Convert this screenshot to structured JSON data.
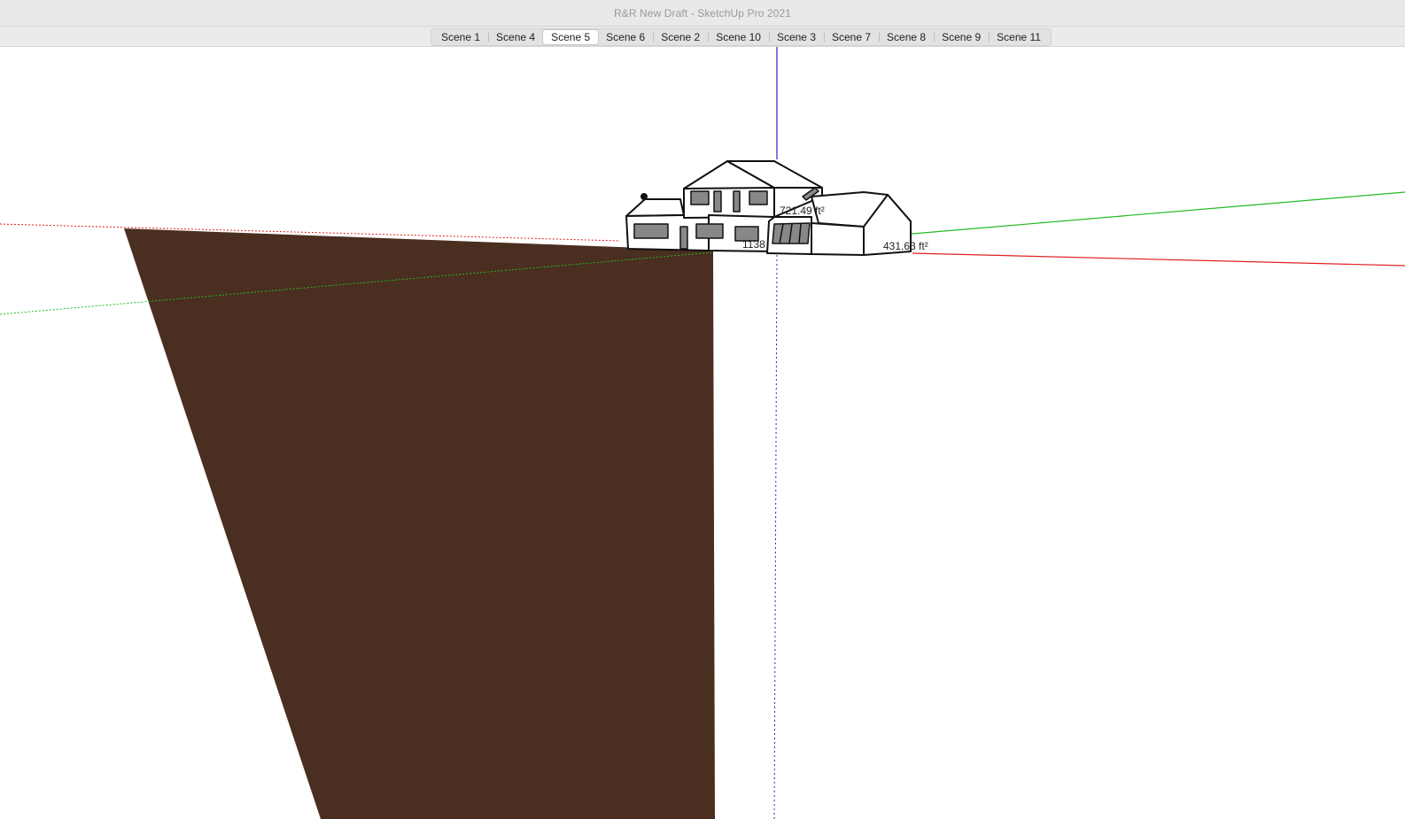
{
  "window": {
    "title": "R&R New Draft - SketchUp Pro 2021"
  },
  "scene_tabs": [
    {
      "label": "Scene 1",
      "active": false
    },
    {
      "label": "Scene 4",
      "active": false
    },
    {
      "label": "Scene 5",
      "active": true
    },
    {
      "label": "Scene 6",
      "active": false
    },
    {
      "label": "Scene 2",
      "active": false
    },
    {
      "label": "Scene 10",
      "active": false
    },
    {
      "label": "Scene 3",
      "active": false
    },
    {
      "label": "Scene 7",
      "active": false
    },
    {
      "label": "Scene 8",
      "active": false
    },
    {
      "label": "Scene 9",
      "active": false
    },
    {
      "label": "Scene 11",
      "active": false
    }
  ],
  "viewport": {
    "area_labels": {
      "upper": "721.49 ft²",
      "middle": "1138",
      "right": "431.63 ft²"
    },
    "colors": {
      "ground": "#4a2e1f",
      "axis_red": "#e02020",
      "axis_green": "#22bb22",
      "axis_blue": "#2424cc",
      "outline": "#111111"
    }
  }
}
